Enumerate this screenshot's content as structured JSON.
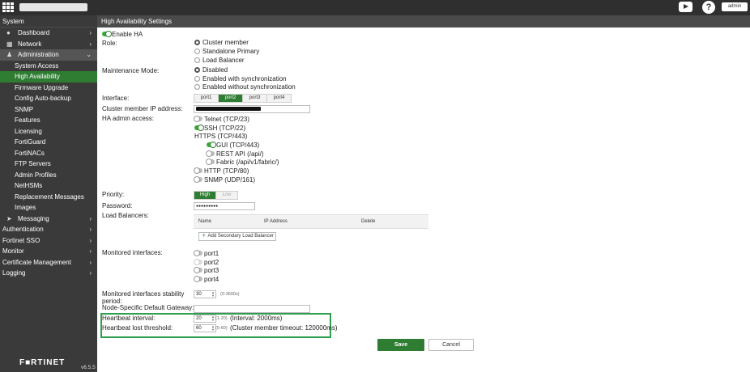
{
  "topbar": {
    "help_glyph": "?",
    "user_label": "admin",
    "icons": [
      "fortinet-grid-logo",
      "youtube-icon",
      "help-icon"
    ]
  },
  "sidebar": {
    "header": "System",
    "items": [
      {
        "label": "Dashboard",
        "icon": "dashboard-icon"
      },
      {
        "label": "Network",
        "icon": "network-icon"
      },
      {
        "label": "Administration",
        "icon": "admin-icon"
      }
    ],
    "sub_items": [
      "System Access",
      "High Availability",
      "Firmware Upgrade",
      "Config Auto-backup",
      "SNMP",
      "Features",
      "Licensing",
      "FortiGuard",
      "FortiNACs",
      "FTP Servers",
      "Admin Profiles",
      "NetHSMs",
      "Replacement Messages",
      "Images"
    ],
    "messaging": {
      "label": "Messaging",
      "icon": "send-icon"
    },
    "sections": [
      "Authentication",
      "Fortinet SSO",
      "Monitor",
      "Certificate Management",
      "Logging"
    ],
    "brand": "F■RTINET",
    "version": "v6.5.5"
  },
  "page": {
    "title": "High Availability Settings",
    "enable_ha": "Enable HA",
    "role_label": "Role:",
    "role_options": [
      "Cluster member",
      "Standalone Primary",
      "Load Balancer"
    ],
    "maintenance_label": "Maintenance Mode:",
    "maintenance_options": [
      "Disabled",
      "Enabled with synchronization",
      "Enabled without synchronization"
    ],
    "interface_label": "Interface:",
    "interface_tabs": [
      "port1",
      "port2",
      "port3",
      "port4"
    ],
    "interface_selected": "port2",
    "cluster_ip_label": "Cluster member IP address:",
    "ha_access_label": "HA admin access:",
    "access": {
      "telnet": "Telnet (TCP/23)",
      "ssh": "SSH (TCP/22)",
      "https": "HTTPS (TCP/443)",
      "gui": "GUI (TCP/443)",
      "rest": "REST API (/api/)",
      "fabric": "Fabric (/api/v1/fabric/)",
      "http": "HTTP (TCP/80)",
      "snmp": "SNMP (UDP/161)"
    },
    "priority_label": "Priority:",
    "priority_options": [
      "High",
      "Low"
    ],
    "priority_selected": "High",
    "password_label": "Password:",
    "password_value": "●●●●●●●●●",
    "load_balancers_label": "Load Balancers:",
    "lb_columns": [
      "Name",
      "IP Address",
      "Delete"
    ],
    "add_lb_button": "Add Secondary Load Balancer",
    "monitored_label": "Monitored interfaces:",
    "monitored_ports": [
      "port1",
      "port2",
      "port3",
      "port4"
    ],
    "stability_label_1": "Monitored interfaces stability",
    "stability_label_2": "period:",
    "stability_value": "30",
    "stability_hint": "(0-3600s)",
    "gateway_label": "Node-Specific Default Gateway:",
    "heartbeat_label": "Heartbeat interval:",
    "heartbeat_value": "20",
    "heartbeat_hint": "(1-20)",
    "heartbeat_note": "(Interval: 2000ms)",
    "threshold_label": "Heartbeat lost threshold:",
    "threshold_value": "60",
    "threshold_hint": "(5-60)",
    "threshold_note": "(Cluster member timeout: 120000ms)",
    "save": "Save",
    "cancel": "Cancel"
  },
  "colors": {
    "accent": "#2e7d32",
    "topbar": "#2f2f2f",
    "sidebar": "#3a3a3a",
    "highlight": "#2e9e4f"
  }
}
